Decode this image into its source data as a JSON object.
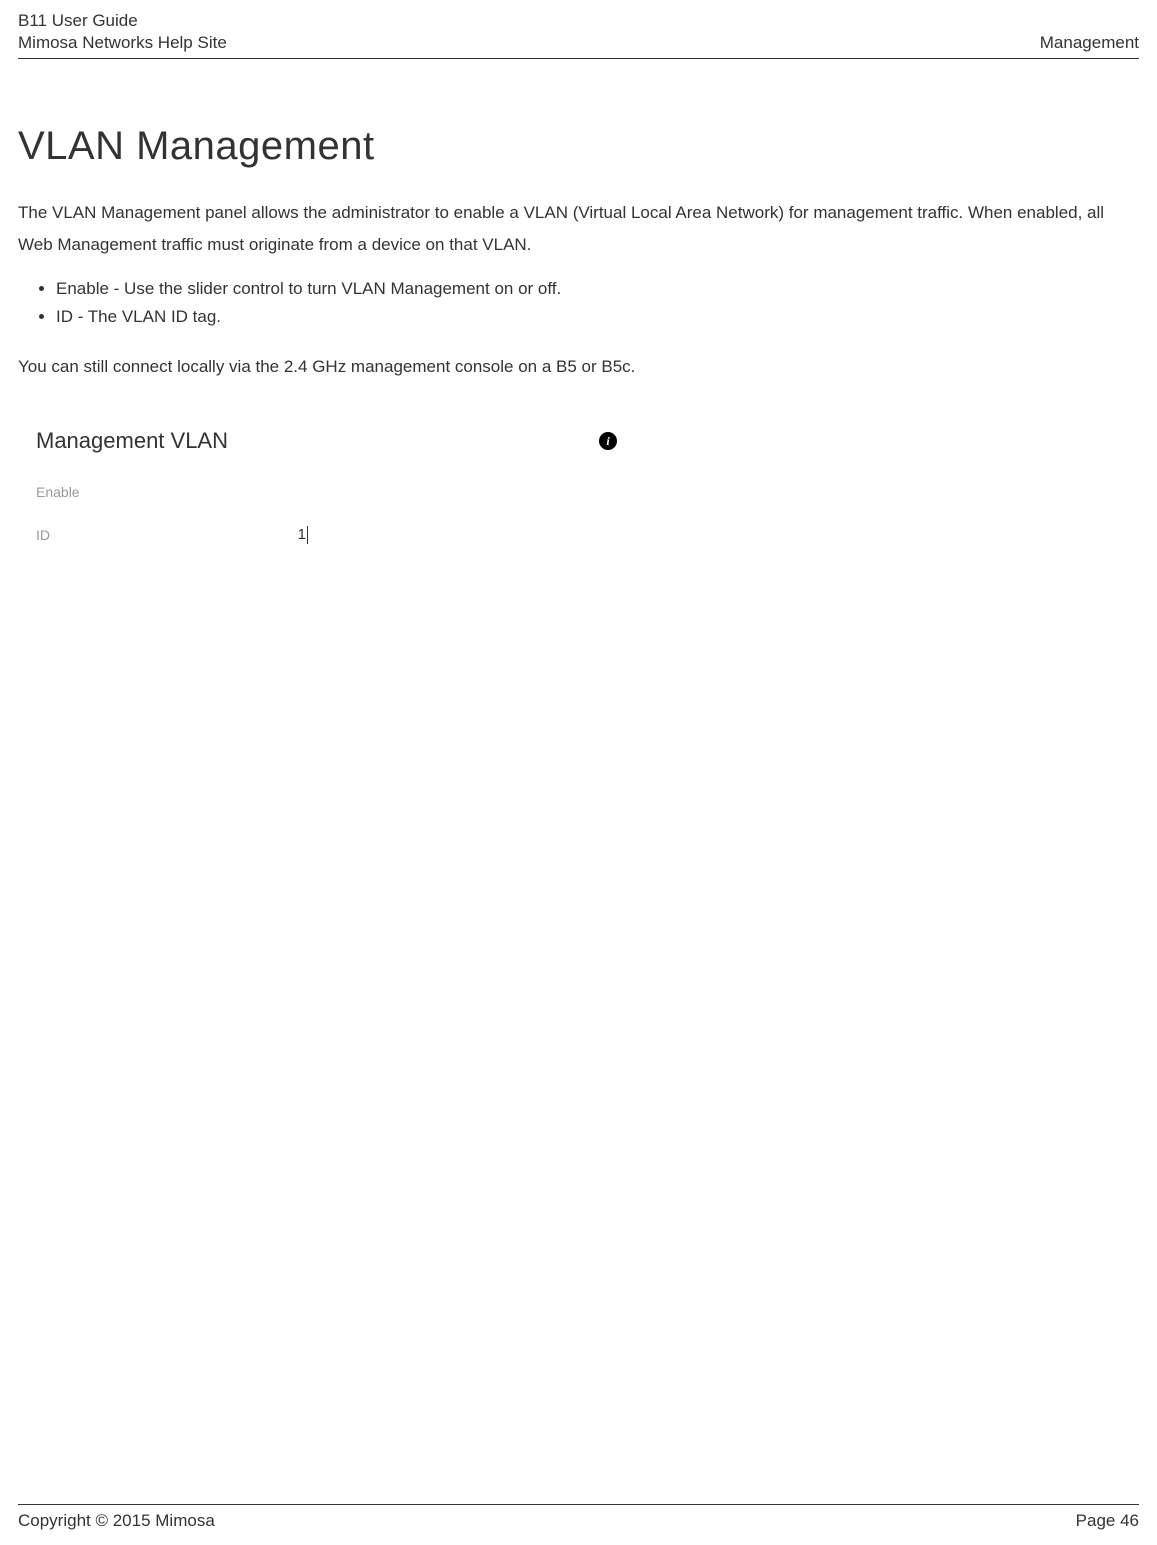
{
  "header": {
    "doc_title": "B11 User Guide",
    "site_name": "Mimosa Networks Help Site",
    "section": "Management"
  },
  "content": {
    "title": "VLAN Management",
    "intro": "The VLAN Management panel allows the administrator to enable a VLAN (Virtual Local Area Network) for management traffic. When enabled, all Web Management traffic must originate from a device on that VLAN.",
    "bullets": [
      "Enable - Use the slider control to turn VLAN Management on or off.",
      "ID - The VLAN ID tag."
    ],
    "note": "You can still connect locally via the 2.4 GHz management console on a B5 or B5c."
  },
  "panel": {
    "title": "Management VLAN",
    "info_icon": "i",
    "fields": {
      "enable": {
        "label": "Enable",
        "value": ""
      },
      "id": {
        "label": "ID",
        "value": "1"
      }
    }
  },
  "footer": {
    "copyright": "Copyright © 2015 Mimosa",
    "page": "Page 46"
  }
}
